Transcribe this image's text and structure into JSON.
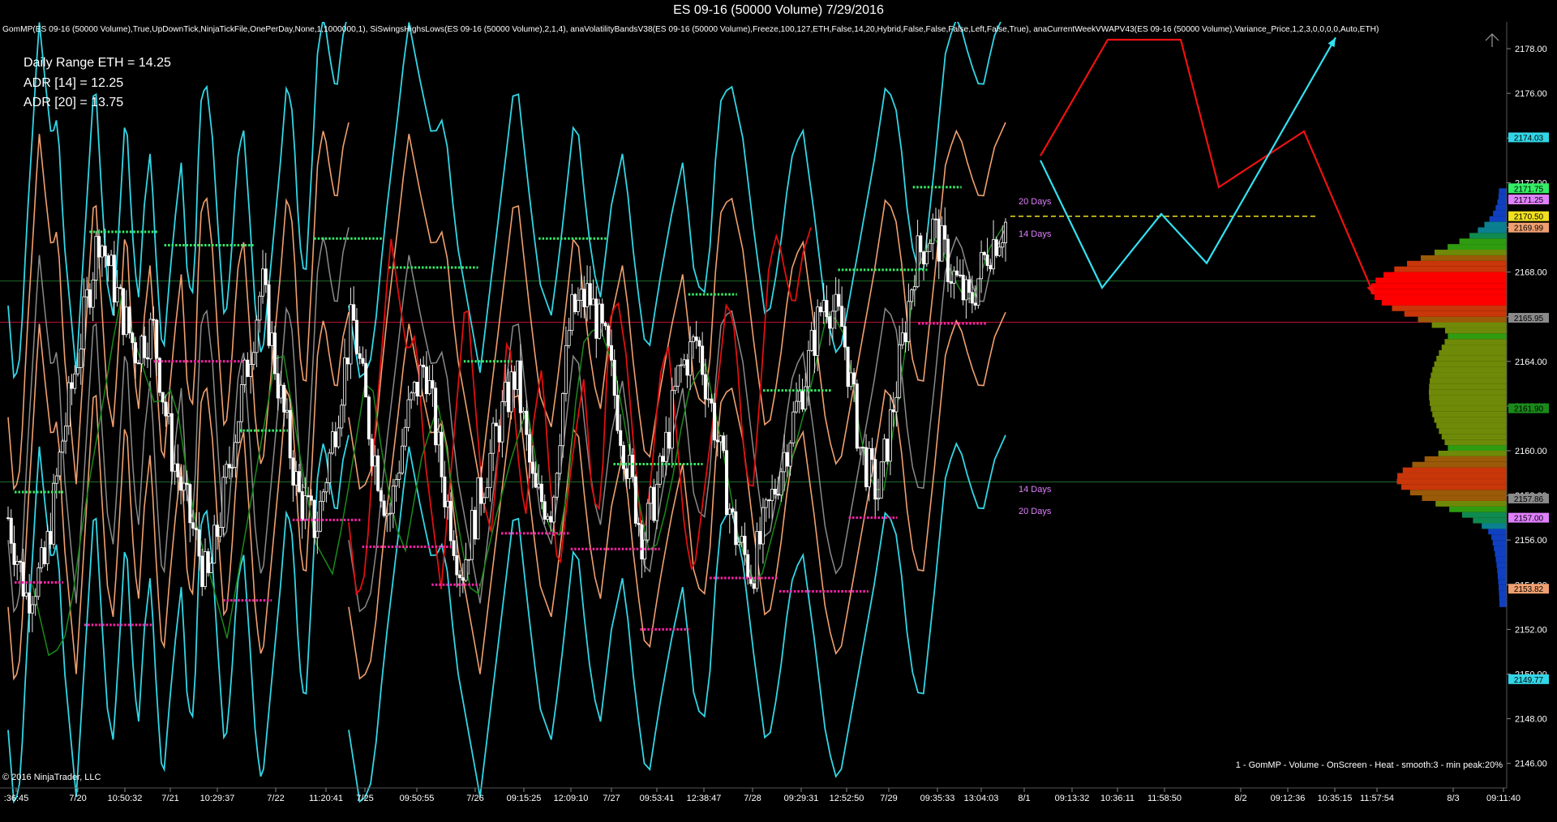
{
  "window": {
    "title": "ES 09-16 (50000 Volume)  7/29/2016"
  },
  "indicator_line": "GomMP(ES 09-16 (50000 Volume),True,UpDownTick,NinjaTickFile,OnePerDay,None,1,1000000,1), SiSwingsHighsLows(ES 09-16 (50000 Volume),2,1,4), anaVolatilityBandsV38(ES 09-16 (50000 Volume),Freeze,100,127,ETH,False,14,20,Hybrid,False,False,False,Left,False,True), anaCurrentWeekVWAPV43(ES 09-16 (50000 Volume),Variance_Price,1,2,3,0,0,0,0,Auto,ETH)",
  "stats": {
    "daily_range": "Daily Range ETH = 14.25",
    "adr14": "ADR [14] = 12.25",
    "adr20": "ADR [20] = 13.75"
  },
  "copyright": "© 2016 NinjaTrader, LLC",
  "profile_caption": "1 - GomMP - Volume - OnScreen - Heat - smooth:3 - min peak:20%",
  "projection_labels": {
    "upper20": "20 Days",
    "upper14": "14 Days",
    "lower14": "14 Days",
    "lower20": "20 Days"
  },
  "colors": {
    "background": "#000000",
    "cyan_band": "#33d6e6",
    "orange_band": "#f0a070",
    "gray_vwap": "#8a8a8a",
    "red_ma": "#e01010",
    "green_ma": "#1a8a1a",
    "swing_high": "#33ee66",
    "swing_low": "#ff22aa",
    "label_pink": "#e080ff",
    "arrow_red": "#ee1111",
    "arrow_cyan": "#33e0f0",
    "dashed_level": "#f0e020"
  },
  "chart_data": {
    "type": "candlestick",
    "y_axis": {
      "min": 2144.9,
      "max": 2179.2,
      "ticks": [
        2146.0,
        2148.0,
        2150.0,
        2152.0,
        2154.0,
        2156.0,
        2158.0,
        2160.0,
        2162.0,
        2164.0,
        2166.0,
        2168.0,
        2170.0,
        2172.0,
        2174.0,
        2176.0,
        2178.0
      ]
    },
    "x_tick_labels": [
      ":36:45",
      "7/20",
      "10:50:32",
      "7/21",
      "10:29:37",
      "7/22",
      "11:20:41",
      "7/25",
      "09:50:55",
      "7/26",
      "09:15:25",
      "12:09:10",
      "7/27",
      "09:53:41",
      "12:38:47",
      "7/28",
      "09:29:31",
      "12:52:50",
      "7/29",
      "09:35:33",
      "13:04:03",
      "8/1",
      "09:13:32",
      "10:36:11",
      "11:58:50",
      "8/2",
      "09:12:36",
      "10:35:15",
      "11:57:54",
      "8/3",
      "09:11:40"
    ],
    "price_tags": [
      {
        "value": 2174.03,
        "label": "2174.03",
        "color": "#33d6e6"
      },
      {
        "value": 2171.75,
        "label": "2171.75",
        "color": "#33ee66"
      },
      {
        "value": 2171.25,
        "label": "2171.25",
        "color": "#e080ff"
      },
      {
        "value": 2170.5,
        "label": "2170.50",
        "color": "#f0e020"
      },
      {
        "value": 2169.99,
        "label": "2169.99",
        "color": "#f0a070"
      },
      {
        "value": 2165.95,
        "label": "2165.95",
        "color": "#8a8a8a"
      },
      {
        "value": 2161.9,
        "label": "2161.90",
        "color": "#1a8a1a"
      },
      {
        "value": 2157.86,
        "label": "2157.86",
        "color": "#8a8a8a"
      },
      {
        "value": 2157.0,
        "label": "2157.00",
        "color": "#e080ff"
      },
      {
        "value": 2153.82,
        "label": "2153.82",
        "color": "#f0a070"
      },
      {
        "value": 2149.77,
        "label": "2149.77",
        "color": "#33d6e6"
      }
    ],
    "horizontal_levels": [
      {
        "value": 2167.6,
        "color": "#1f6a2a"
      },
      {
        "value": 2165.75,
        "color": "#b81030"
      },
      {
        "value": 2158.6,
        "color": "#1f6a2a"
      }
    ],
    "dashed_level": 2170.5,
    "close_path": [
      2157.0,
      2153.5,
      2154.8,
      2160.5,
      2165.0,
      2169.8,
      2167.0,
      2164.5,
      2165.5,
      2160.0,
      2157.0,
      2154.0,
      2158.5,
      2163.0,
      2167.5,
      2162.5,
      2158.0,
      2156.5,
      2161.0,
      2166.0,
      2160.5,
      2157.0,
      2161.5,
      2164.0,
      2158.5,
      2154.5,
      2158.0,
      2161.0,
      2163.5,
      2158.0,
      2157.5,
      2166.0,
      2167.0,
      2164.5,
      2160.0,
      2156.0,
      2159.0,
      2163.5,
      2165.0,
      2161.0,
      2156.5,
      2154.5,
      2157.5,
      2160.5,
      2163.5,
      2167.0,
      2165.5,
      2160.0,
      2158.0,
      2163.0,
      2168.5,
      2170.0,
      2168.0,
      2166.5,
      2169.0,
      2170.2
    ],
    "swing_highs": [
      {
        "from": "7/20 early",
        "value": 2158.15
      },
      {
        "from": "7/20 late",
        "value": 2169.8
      },
      {
        "from": "7/21",
        "value": 2169.2
      },
      {
        "from": "7/22",
        "value": 2160.9
      },
      {
        "from": "7/25",
        "value": 2169.5
      },
      {
        "from": "7/26",
        "value": 2168.2
      },
      {
        "from": "7/26 pm",
        "value": 2164.0
      },
      {
        "from": "7/27",
        "value": 2169.5
      },
      {
        "from": "7/27 pm",
        "value": 2159.4
      },
      {
        "from": "7/28",
        "value": 2167.0
      },
      {
        "from": "7/28 pm",
        "value": 2162.7
      },
      {
        "from": "7/29",
        "value": 2168.1
      },
      {
        "from": "7/29 pm",
        "value": 2171.8
      }
    ],
    "swing_lows": [
      {
        "from": "7/20 early",
        "value": 2154.1
      },
      {
        "from": "7/20 late",
        "value": 2152.2
      },
      {
        "from": "7/21",
        "value": 2164.0
      },
      {
        "from": "7/22",
        "value": 2153.3
      },
      {
        "from": "7/25",
        "value": 2156.9
      },
      {
        "from": "7/26",
        "value": 2155.7
      },
      {
        "from": "7/26 pm",
        "value": 2154.0
      },
      {
        "from": "7/27",
        "value": 2156.3
      },
      {
        "from": "7/27 pm",
        "value": 2155.6
      },
      {
        "from": "7/27 late",
        "value": 2152.0
      },
      {
        "from": "7/28",
        "value": 2154.3
      },
      {
        "from": "7/28 pm",
        "value": 2153.7
      },
      {
        "from": "7/29",
        "value": 2157.0
      },
      {
        "from": "7/29 pm",
        "value": 2165.7
      }
    ],
    "projection_red": [
      2173.2,
      2178.4,
      2178.4,
      2171.8,
      2174.3,
      2167.0
    ],
    "projection_cyan": [
      2173.0,
      2167.3,
      2170.6,
      2168.4,
      2178.5
    ],
    "volume_profile": {
      "peak_price": 2167.1,
      "secondary_peak": 2158.6,
      "low": 2153.0,
      "high": 2171.5
    }
  }
}
